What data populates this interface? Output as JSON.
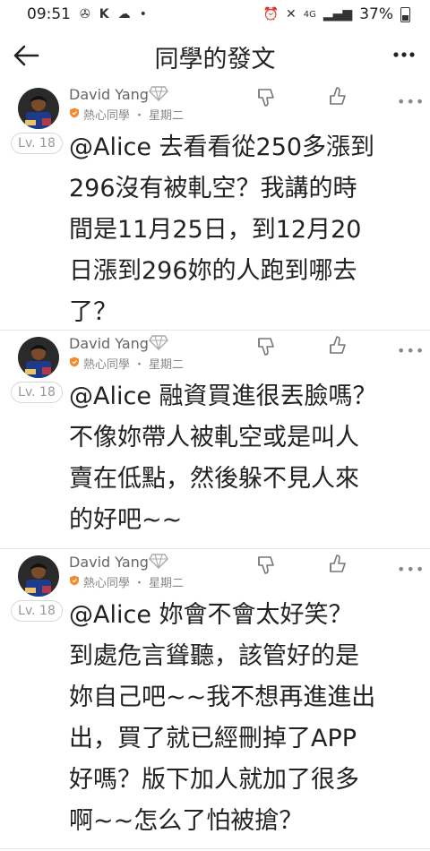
{
  "status_bar": {
    "time": "09:51",
    "left_icons": [
      "fan-icon",
      "k-icon",
      "cloud-icon",
      "dot-icon"
    ],
    "battery_pct": "37%",
    "right_icons": [
      "alarm-icon",
      "mute-icon",
      "network-4g-icon",
      "signal-icon",
      "battery-icon"
    ]
  },
  "header": {
    "title": "同學的發文",
    "back_icon": "arrow-left-icon",
    "more_icon": "ellipsis-icon"
  },
  "posts": [
    {
      "author": "David Yang",
      "role": "熱心同學",
      "separator": "・",
      "day": "星期二",
      "level": "Lv. 18",
      "text": "@Alice 去看看從250多漲到\n296沒有被軋空？我講的時\n間是11月25日，到12月20\n日漲到296妳的人跑到哪去\n了？"
    },
    {
      "author": "David Yang",
      "role": "熱心同學",
      "separator": "・",
      "day": "星期二",
      "level": "Lv. 18",
      "text": "@Alice 融資買進很丟臉嗎？\n不像妳帶人被軋空或是叫人\n賣在低點，然後躲不見人來\n的好吧~~"
    },
    {
      "author": "David Yang",
      "role": "熱心同學",
      "separator": "・",
      "day": "星期二",
      "level": "Lv. 18",
      "text": "@Alice 妳會不會太好笑？\n到處危言聳聽，該管好的是\n妳自己吧~~我不想再進進出\n出，買了就已經刪掉了APP\n好嗎？版下加人就加了很多\n啊~~怎么了怕被搶？"
    }
  ]
}
